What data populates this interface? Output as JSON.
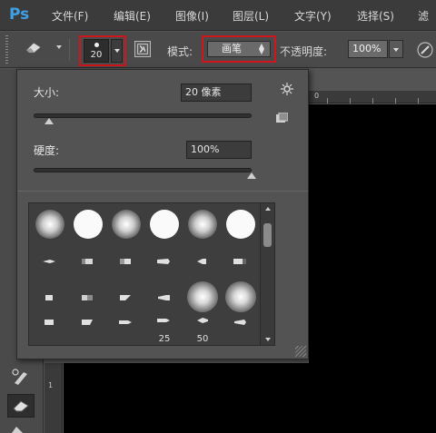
{
  "menubar": {
    "logo": "Ps",
    "items": [
      "文件(F)",
      "编辑(E)",
      "图像(I)",
      "图层(L)",
      "文字(Y)",
      "选择(S)",
      "滤"
    ]
  },
  "options": {
    "tool_icon": "eraser-icon",
    "brush_size": "20",
    "mode_label": "模式:",
    "mode_value": "画笔",
    "opacity_label": "不透明度:",
    "opacity_value": "100%",
    "airbrush_icon": "airbrush-icon",
    "highlight_color": "#d4141c"
  },
  "brush_popup": {
    "size_label": "大小:",
    "size_value": "20 像素",
    "size_slider_fraction": 0.07,
    "hardness_label": "硬度:",
    "hardness_value": "100%",
    "hardness_slider_fraction": 1.0,
    "presets_row4_labels": [
      "25",
      "50"
    ]
  },
  "rulers": {
    "top_zero": "0",
    "left_one": "1"
  }
}
